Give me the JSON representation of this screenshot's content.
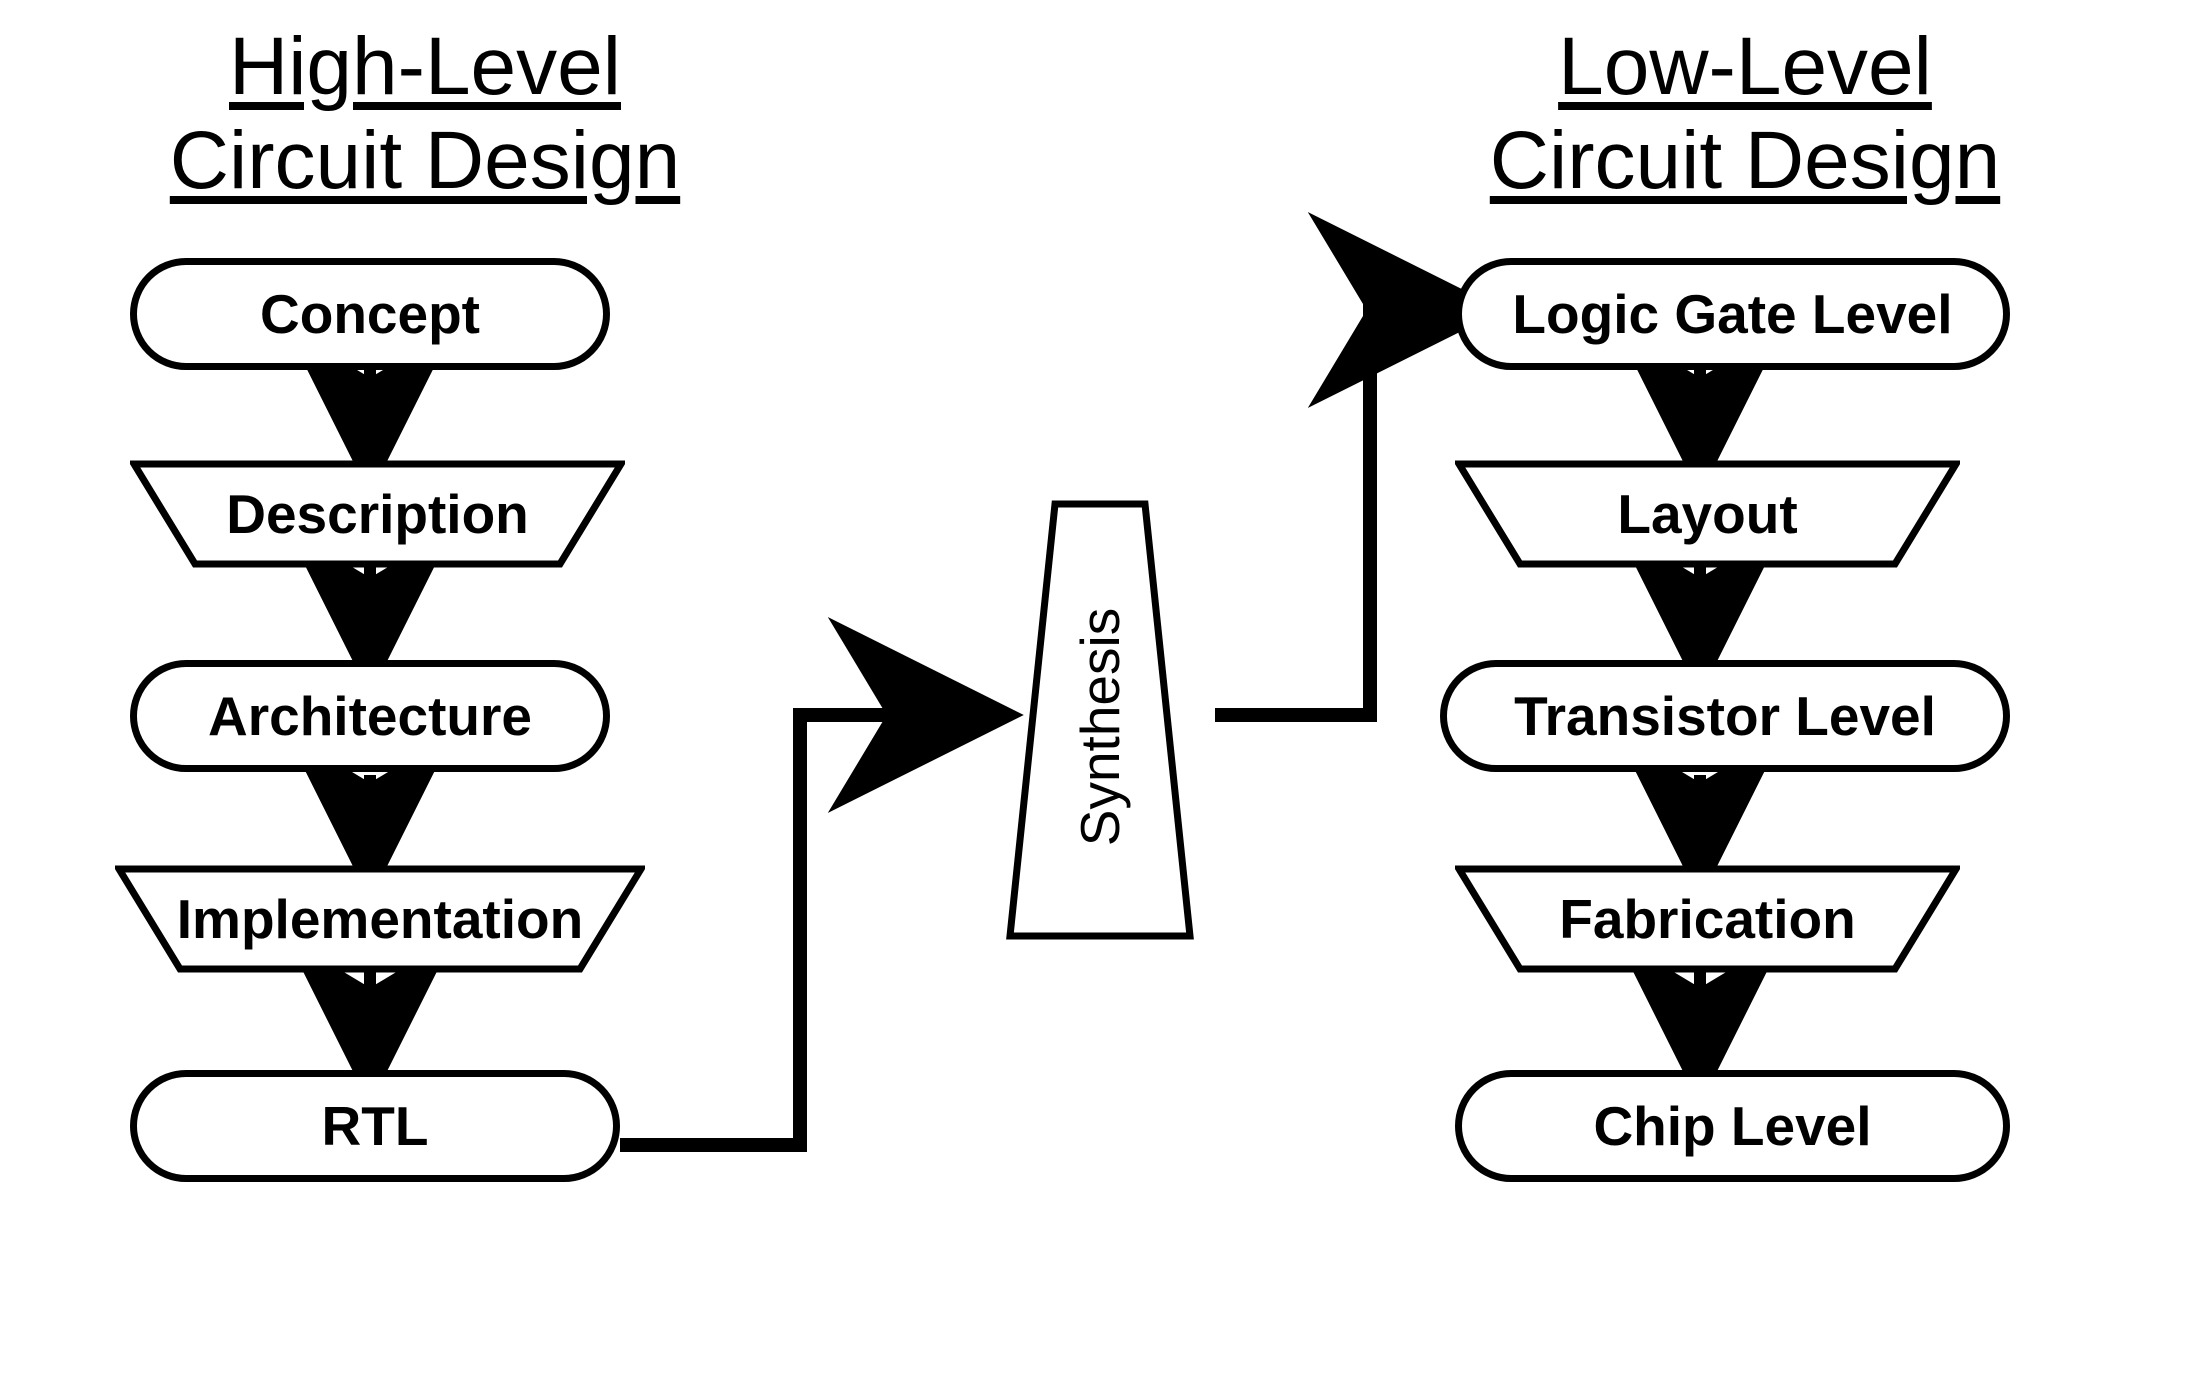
{
  "headings": {
    "left_line1": "High-Level",
    "left_line2": "Circuit Design",
    "right_line1": "Low-Level",
    "right_line2": "Circuit Design"
  },
  "left_column": {
    "node1": "Concept",
    "node2": "Description",
    "node3": "Architecture",
    "node4": "Implementation",
    "node5": "RTL"
  },
  "center": {
    "synthesis": "Synthesis"
  },
  "right_column": {
    "node1": "Logic Gate Level",
    "node2": "Layout",
    "node3": "Transistor Level",
    "node4": "Fabrication",
    "node5": "Chip Level"
  }
}
